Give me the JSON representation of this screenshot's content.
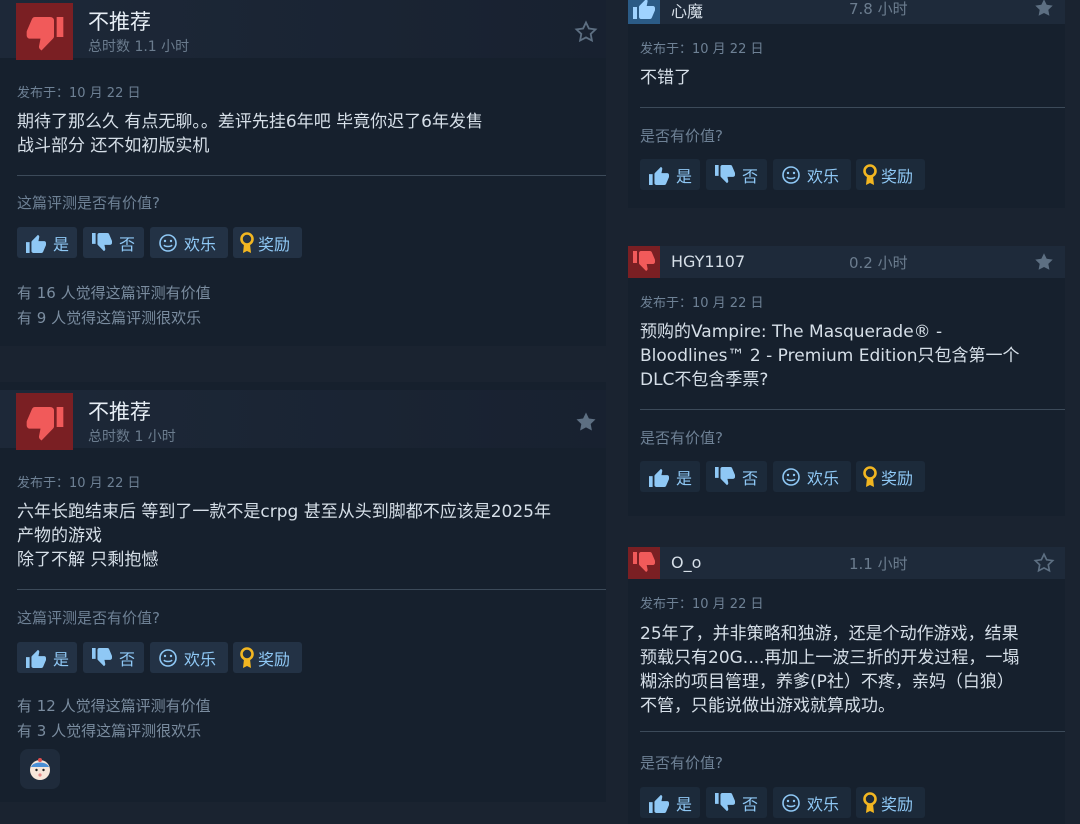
{
  "left_reviews": [
    {
      "verdict": "不推荐",
      "hours": "总时数 1.1 小时",
      "date": "发布于：10 月 22 日",
      "body_lines": [
        "期待了那么久 有点无聊。。差评先挂6年吧 毕竟你迟了6年发售",
        "战斗部分 还不如初版实机"
      ],
      "helpful_prompt": "这篇评测是否有价值?",
      "buttons": {
        "yes": "是",
        "no": "否",
        "funny": "欢乐",
        "award": "奖励"
      },
      "stats": [
        "有 16 人觉得这篇评测有价值",
        "有 9 人觉得这篇评测很欢乐"
      ]
    },
    {
      "verdict": "不推荐",
      "hours": "总时数 1 小时",
      "date": "发布于：10 月 22 日",
      "body_lines": [
        "六年长跑结束后 等到了一款不是crpg 甚至从头到脚都不应该是2025年",
        "产物的游戏",
        "除了不解 只剩抱憾"
      ],
      "helpful_prompt": "这篇评测是否有价值?",
      "buttons": {
        "yes": "是",
        "no": "否",
        "funny": "欢乐",
        "award": "奖励"
      },
      "stats": [
        "有 12 人觉得这篇评测有价值",
        "有 3 人觉得这篇评测很欢乐"
      ],
      "reaction_icon": "baby-face-emoji"
    }
  ],
  "right_reviews": [
    {
      "name": "心魔",
      "hours": "7.8 小时",
      "recommended": true,
      "date": "发布于：10 月 22 日",
      "body_lines": [
        "不错了"
      ],
      "helpful_prompt": "是否有价值?",
      "buttons": {
        "yes": "是",
        "no": "否",
        "funny": "欢乐",
        "award": "奖励"
      }
    },
    {
      "name": "HGY1107",
      "hours": "0.2 小时",
      "recommended": false,
      "date": "发布于：10 月 22 日",
      "body_lines": [
        "预购的Vampire: The Masquerade® -",
        "Bloodlines™ 2 - Premium Edition只包含第一个",
        "DLC不包含季票?"
      ],
      "helpful_prompt": "是否有价值?",
      "buttons": {
        "yes": "是",
        "no": "否",
        "funny": "欢乐",
        "award": "奖励"
      }
    },
    {
      "name": "O_o",
      "hours": "1.1 小时",
      "recommended": false,
      "date": "发布于：10 月 22 日",
      "body_lines": [
        "25年了，并非策略和独游，还是个动作游戏，结果",
        "预载只有20G....再加上一波三折的开发过程，一塌",
        "糊涂的项目管理，养爹(P社）不疼，亲妈（白狼）",
        "不管，只能说做出游戏就算成功。"
      ],
      "helpful_prompt": "是否有价值?",
      "buttons": {
        "yes": "是",
        "no": "否",
        "funny": "欢乐",
        "award": "奖励"
      }
    }
  ],
  "colors": {
    "accent_text": "#8fc8f5",
    "not_recommended": "#7a1f23",
    "recommended": "#2b5b86",
    "award_gold": "#f2b621"
  }
}
